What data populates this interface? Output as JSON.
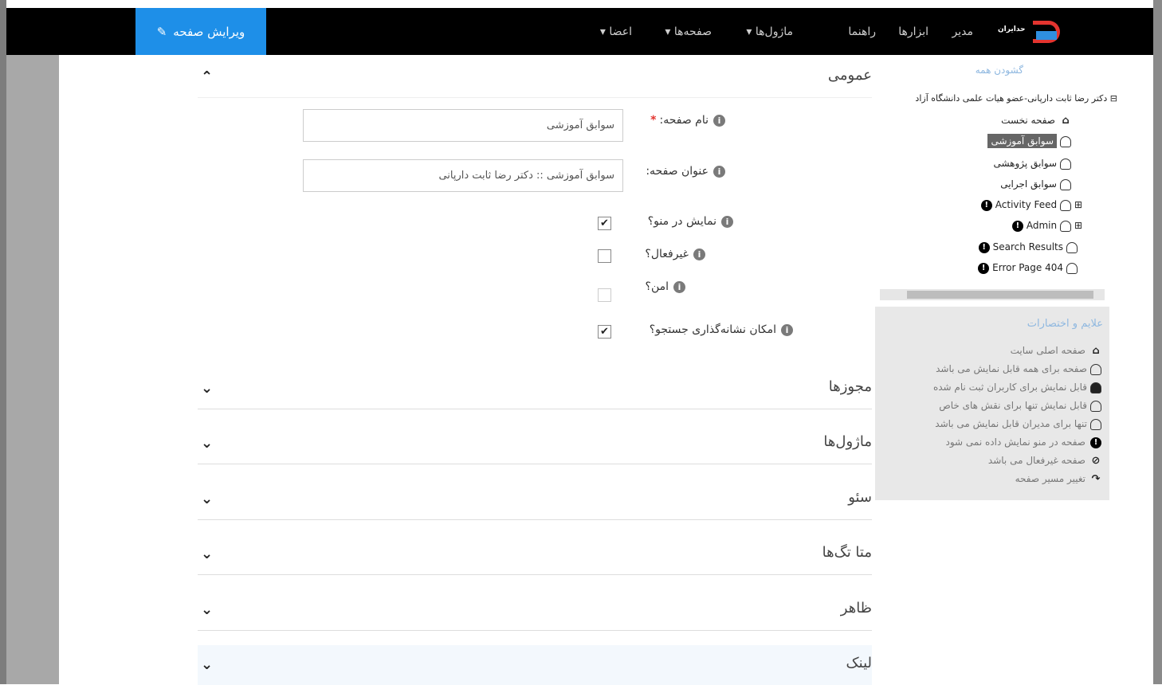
{
  "topbar": {
    "logo_text": "حدایران",
    "nav": {
      "admin": "مدیر",
      "tools": "ابزارها",
      "guides": "راهنما",
      "modules": "ماژول‌ها ▾",
      "pages": "صفحه‌ها ▾",
      "members": "اعضا ▾"
    },
    "edit_page": "ویرایش صفحه"
  },
  "form": {
    "general_title": "عمومی",
    "page_name_label": "نام صفحه:",
    "page_name_value": "سوابق آموزشی",
    "page_title_label": "عنوان صفحه:",
    "page_title_value": "سوابق آموزشی :: دکتر رضا ثابت دارپانی",
    "show_in_menu_label": "نمایش در منو؟",
    "disabled_label": "غیرفعال؟",
    "secure_label": "امن؟",
    "searchable_label": "امکان نشانه‌گذاری جستجو؟",
    "show_in_menu_checked": true,
    "disabled_checked": false,
    "secure_checked": false,
    "searchable_checked": true
  },
  "sections": [
    {
      "title": "مجوزها"
    },
    {
      "title": "ماژول‌ها"
    },
    {
      "title": "سئو"
    },
    {
      "title": "متا تگ‌ها"
    },
    {
      "title": "ظاهر"
    },
    {
      "title": "لینک"
    }
  ],
  "tree": {
    "expand_all": "گشودن همه",
    "root": "دکتر رضا ثابت دارپانی-عضو هیات علمی دانشگاه آزاد",
    "items": [
      {
        "label": "صفحه نخست",
        "icon": "home-icon"
      },
      {
        "label": "سوابق آموزشی",
        "icon": "user-icon",
        "selected": true
      },
      {
        "label": "سوابق پژوهشی",
        "icon": "user-icon"
      },
      {
        "label": "سوابق اجرایی",
        "icon": "user-icon"
      },
      {
        "label": "Activity Feed",
        "icon": "user-icon",
        "hidden": true
      },
      {
        "label": "Admin",
        "icon": "admin-user-icon",
        "hidden": true
      },
      {
        "label": "Search Results",
        "icon": "user-icon",
        "hidden": true
      },
      {
        "label": "Error Page 404",
        "icon": "user-icon",
        "hidden": true
      }
    ]
  },
  "legend": {
    "title": "علایم و اختصارات",
    "items": [
      "صفحه اصلی سایت",
      "صفحه برای همه قابل نمایش می باشد",
      "قابل نمایش برای کاربران ثبت نام شده",
      "قابل نمایش تنها برای نقش های خاص",
      "تنها برای مدیران قابل نمایش می باشد",
      "صفحه در منو نمایش داده نمی شود",
      "صفحه غیرفعال می باشد",
      "تغییر مسیر صفحه"
    ]
  },
  "colors": {
    "topbar_bg": "#000000",
    "edit_button_bg": "#1e8fe8",
    "required_star": "#e3342f",
    "link_blue": "#8fb8e0"
  }
}
